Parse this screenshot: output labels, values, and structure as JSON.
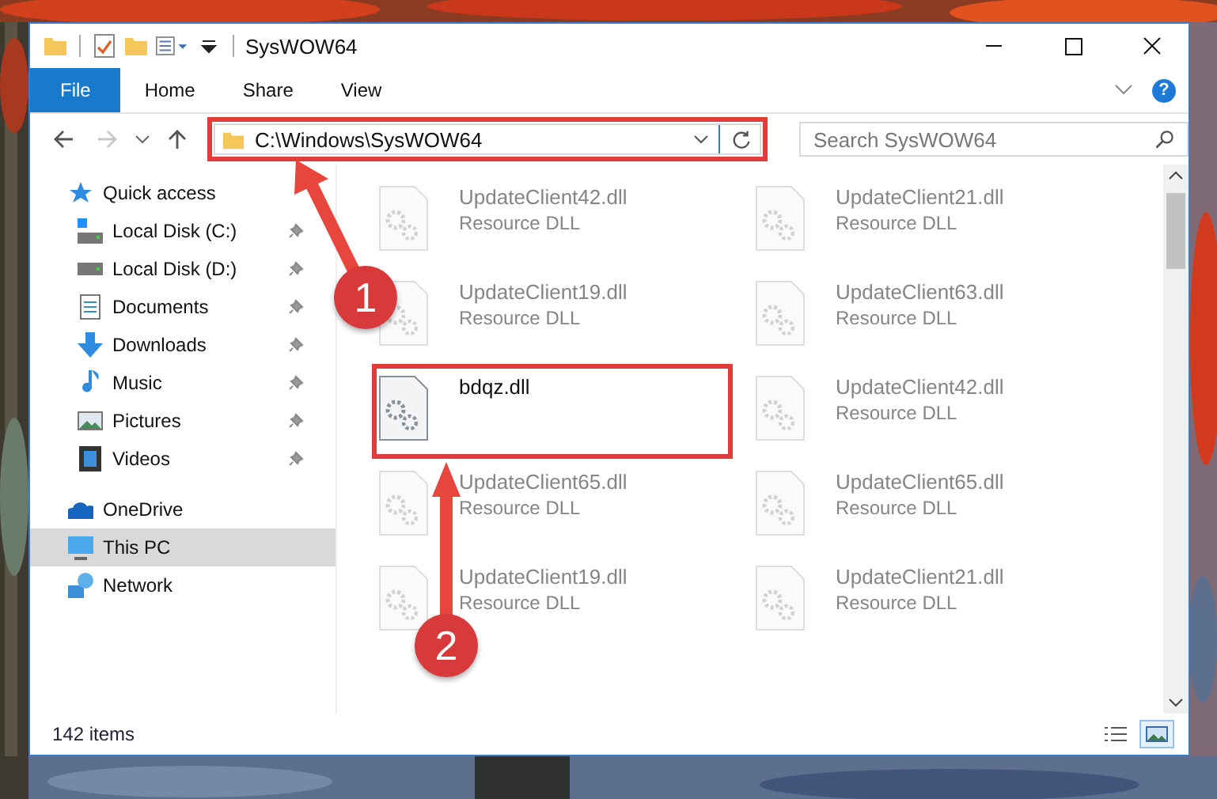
{
  "window": {
    "title": "SysWOW64"
  },
  "ribbon_tabs": [
    {
      "label": "File",
      "kind": "file"
    },
    {
      "label": "Home",
      "kind": "tab"
    },
    {
      "label": "Share",
      "kind": "tab"
    },
    {
      "label": "View",
      "kind": "tab"
    }
  ],
  "help": "?",
  "navigation": {
    "forward_disabled": true
  },
  "address": {
    "value": "C:\\Windows\\SysWOW64",
    "highlighted": true
  },
  "search": {
    "placeholder": "Search SysWOW64"
  },
  "sidebar": {
    "items": [
      {
        "label": "Quick access",
        "kind": "star",
        "selected": false,
        "children": [
          {
            "label": "Local Disk (C:)",
            "kind": "drive-c",
            "pinned": true,
            "selected": false
          },
          {
            "label": "Local Disk (D:)",
            "kind": "drive",
            "pinned": true,
            "selected": false
          },
          {
            "label": "Documents",
            "kind": "documents",
            "pinned": true,
            "selected": false
          },
          {
            "label": "Downloads",
            "kind": "downloads",
            "pinned": true,
            "selected": false
          },
          {
            "label": "Music",
            "kind": "music",
            "pinned": true,
            "selected": false
          },
          {
            "label": "Pictures",
            "kind": "pictures",
            "pinned": true,
            "selected": false
          },
          {
            "label": "Videos",
            "kind": "videos",
            "pinned": true,
            "selected": false
          }
        ]
      },
      {
        "label": "OneDrive",
        "kind": "cloud",
        "selected": false
      },
      {
        "label": "This PC",
        "kind": "pc",
        "selected": true
      },
      {
        "label": "Network",
        "kind": "network",
        "selected": false
      }
    ]
  },
  "files": [
    {
      "name": "UpdateClient42.dll",
      "type": "Resource DLL",
      "highlighted": false
    },
    {
      "name": "UpdateClient21.dll",
      "type": "Resource DLL",
      "highlighted": false
    },
    {
      "name": "UpdateClient19.dll",
      "type": "Resource DLL",
      "highlighted": false
    },
    {
      "name": "UpdateClient63.dll",
      "type": "Resource DLL",
      "highlighted": false
    },
    {
      "name": "bdqz.dll",
      "highlighted": true
    },
    {
      "name": "UpdateClient42.dll",
      "type": "Resource DLL",
      "highlighted": false
    },
    {
      "name": "UpdateClient65.dll",
      "type": "Resource DLL",
      "highlighted": false
    },
    {
      "name": "UpdateClient65.dll",
      "type": "Resource DLL",
      "highlighted": false
    },
    {
      "name": "UpdateClient19.dll",
      "type": "Resource DLL",
      "highlighted": false
    },
    {
      "name": "UpdateClient21.dll",
      "type": "Resource DLL",
      "highlighted": false
    }
  ],
  "status_bar": {
    "count": "142 items",
    "views": [
      {
        "kind": "details",
        "selected": false
      },
      {
        "kind": "large-icons",
        "selected": true
      }
    ]
  },
  "annotations": [
    {
      "number": "1"
    },
    {
      "number": "2"
    }
  ]
}
